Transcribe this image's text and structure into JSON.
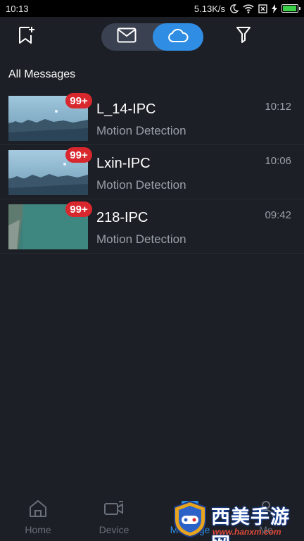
{
  "status_bar": {
    "time": "10:13",
    "net_speed": "5.13K/s",
    "icons": [
      "moon-icon",
      "wifi-icon",
      "no-sim-icon",
      "charging-icon",
      "battery-icon"
    ],
    "battery_level": 0.95,
    "battery_color": "#3ecf4a"
  },
  "toolbar": {
    "left_icon": "bookmark-add-icon",
    "segment": [
      {
        "icon": "mail-icon",
        "active": false
      },
      {
        "icon": "cloud-icon",
        "active": true
      }
    ],
    "right_icon": "filter-icon",
    "accent": "#2f8de4"
  },
  "section": {
    "title": "All Messages"
  },
  "messages": [
    {
      "device": "L_14-IPC",
      "event": "Motion Detection",
      "time": "10:12",
      "badge": "99+"
    },
    {
      "device": "Lxin-IPC",
      "event": "Motion Detection",
      "time": "10:06",
      "badge": "99+"
    },
    {
      "device": "218-IPC",
      "event": "Motion Detection",
      "time": "09:42",
      "badge": "99+"
    }
  ],
  "bottom_nav": [
    {
      "label": "Home",
      "icon": "home-icon"
    },
    {
      "label": "Device",
      "icon": "camera-icon"
    },
    {
      "label": "Message",
      "icon": "message-icon"
    },
    {
      "label": "Me",
      "icon": "person-icon"
    }
  ],
  "watermark": {
    "text": "西美手游网",
    "url": "www.hanxm.com"
  }
}
